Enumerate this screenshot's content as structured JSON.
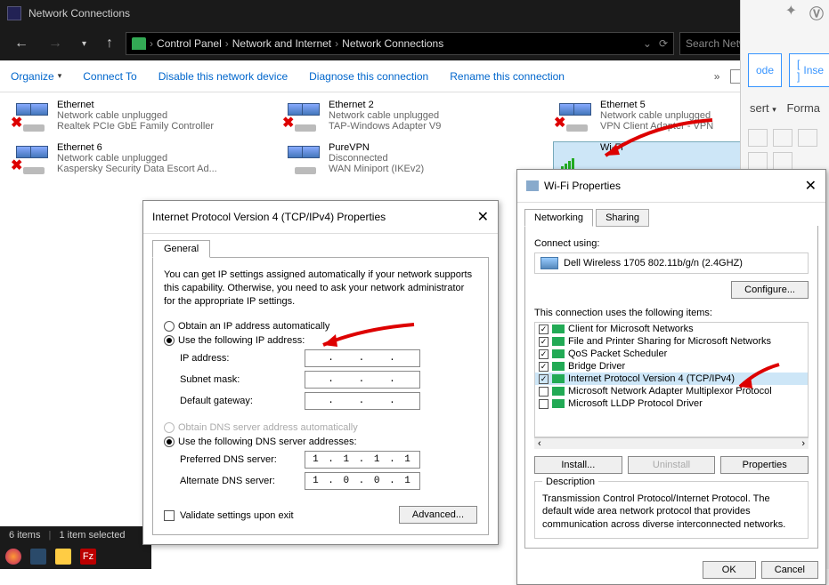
{
  "window": {
    "title": "Network Connections",
    "breadcrumb": [
      "Control Panel",
      "Network and Internet",
      "Network Connections"
    ],
    "search_placeholder": "Search Network Co..."
  },
  "commands": {
    "organize": "Organize",
    "connect_to": "Connect To",
    "disable": "Disable this network device",
    "diagnose": "Diagnose this connection",
    "rename": "Rename this connection"
  },
  "adapters": [
    {
      "name": "Ethernet",
      "status": "Network cable unplugged",
      "desc": "Realtek PCIe GbE Family Controller",
      "unplugged": true
    },
    {
      "name": "Ethernet 2",
      "status": "Network cable unplugged",
      "desc": "TAP-Windows Adapter V9",
      "unplugged": true
    },
    {
      "name": "Ethernet 5",
      "status": "Network cable unplugged",
      "desc": "VPN Client Adapter - VPN",
      "unplugged": true
    },
    {
      "name": "Ethernet 6",
      "status": "Network cable unplugged",
      "desc": "Kaspersky Security Data Escort Ad...",
      "unplugged": true
    },
    {
      "name": "PureVPN",
      "status": "Disconnected",
      "desc": "WAN Miniport (IKEv2)",
      "unplugged": false
    },
    {
      "name": "Wi-Fi",
      "status": "",
      "desc": "",
      "wifi": true,
      "selected": true
    }
  ],
  "statusbar": {
    "items_count": "6 items",
    "selection": "1 item selected"
  },
  "ipv4_dialog": {
    "title": "Internet Protocol Version 4 (TCP/IPv4) Properties",
    "tab": "General",
    "description": "You can get IP settings assigned automatically if your network supports this capability. Otherwise, you need to ask your network administrator for the appropriate IP settings.",
    "radio_auto_ip": "Obtain an IP address automatically",
    "radio_manual_ip": "Use the following IP address:",
    "ip_label": "IP address:",
    "subnet_label": "Subnet mask:",
    "gateway_label": "Default gateway:",
    "radio_auto_dns": "Obtain DNS server address automatically",
    "radio_manual_dns": "Use the following DNS server addresses:",
    "pref_dns_label": "Preferred DNS server:",
    "alt_dns_label": "Alternate DNS server:",
    "pref_dns_value": "1 . 1 . 1 . 1",
    "alt_dns_value": "1 . 0 . 0 . 1",
    "ip_value": ".   .   .",
    "subnet_value": ".   .   .",
    "gateway_value": ".   .   .",
    "validate_label": "Validate settings upon exit",
    "advanced_btn": "Advanced..."
  },
  "wifi_dialog": {
    "title": "Wi-Fi Properties",
    "tabs": {
      "networking": "Networking",
      "sharing": "Sharing"
    },
    "connect_using_label": "Connect using:",
    "adapter_name": "Dell Wireless 1705 802.11b/g/n (2.4GHZ)",
    "configure_btn": "Configure...",
    "items_label": "This connection uses the following items:",
    "items": [
      {
        "checked": true,
        "label": "Client for Microsoft Networks"
      },
      {
        "checked": true,
        "label": "File and Printer Sharing for Microsoft Networks"
      },
      {
        "checked": true,
        "label": "QoS Packet Scheduler"
      },
      {
        "checked": true,
        "label": "Bridge Driver"
      },
      {
        "checked": true,
        "label": "Internet Protocol Version 4 (TCP/IPv4)",
        "highlight": true
      },
      {
        "checked": false,
        "label": "Microsoft Network Adapter Multiplexor Protocol"
      },
      {
        "checked": false,
        "label": "Microsoft LLDP Protocol Driver"
      }
    ],
    "install_btn": "Install...",
    "uninstall_btn": "Uninstall",
    "properties_btn": "Properties",
    "desc_label": "Description",
    "desc_text": "Transmission Control Protocol/Internet Protocol. The default wide area network protocol that provides communication across diverse interconnected networks.",
    "ok_btn": "OK",
    "cancel_btn": "Cancel"
  },
  "bg_window": {
    "btn1": "ode",
    "btn2": "Inse",
    "label1": "sert",
    "label2": "Forma"
  }
}
